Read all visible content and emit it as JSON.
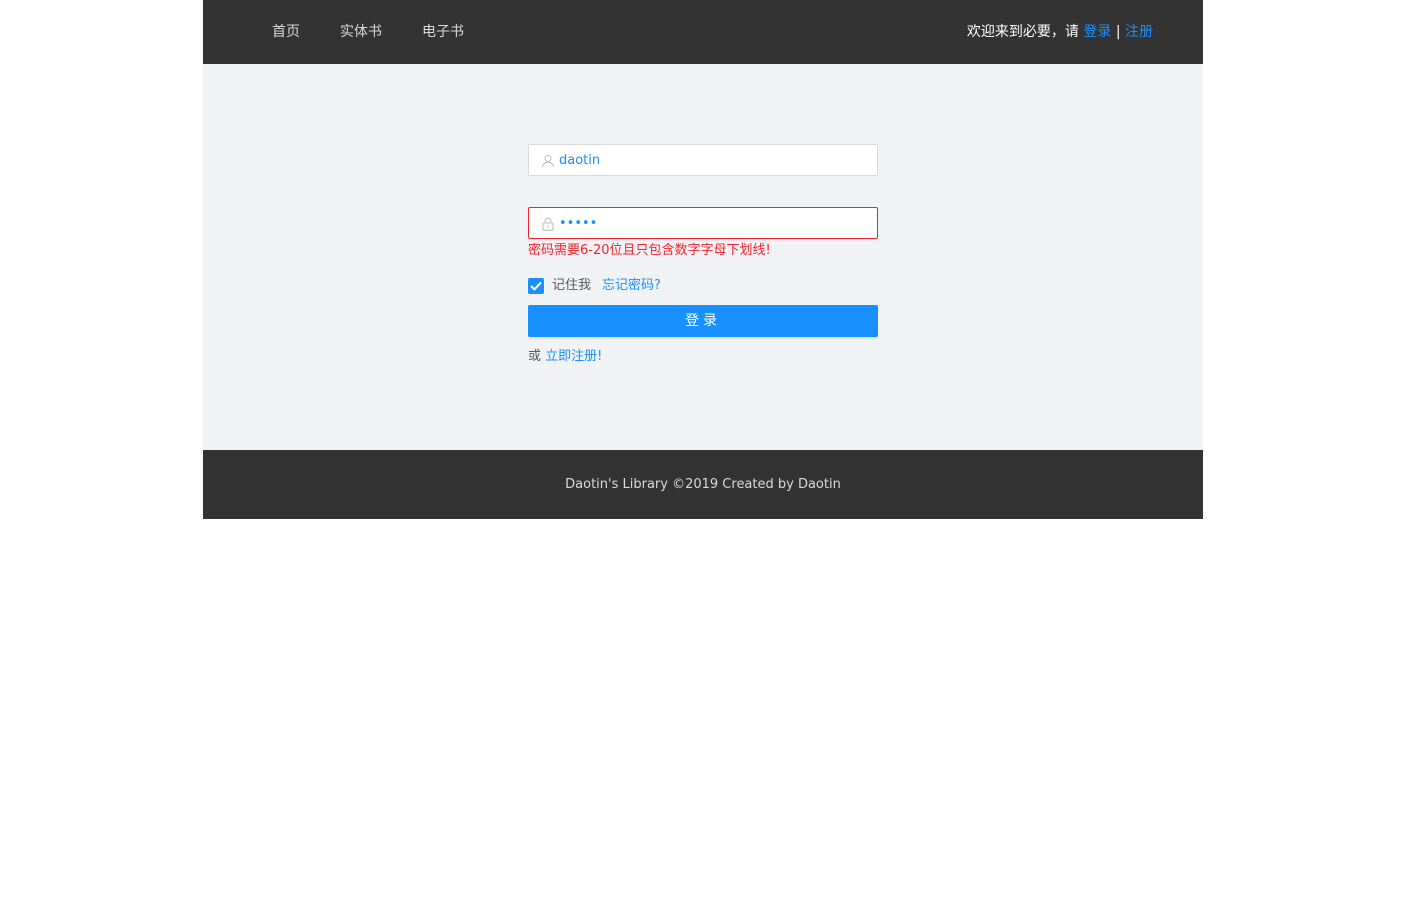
{
  "header": {
    "nav": [
      {
        "label": "首页"
      },
      {
        "label": "实体书"
      },
      {
        "label": "电子书"
      }
    ],
    "welcome_text": "欢迎来到必要，请 ",
    "login_link": "登录",
    "separator": " | ",
    "register_link": "注册"
  },
  "form": {
    "username_value": "daotin",
    "username_icon": "user-icon",
    "password_value": "•••••",
    "password_icon": "lock-icon",
    "password_error": "密码需要6-20位且只包含数字字母下划线!",
    "remember_label": "记住我",
    "remember_checked": true,
    "forgot_link": "忘记密码?",
    "login_button": "登录",
    "register_prefix": "或 ",
    "register_link": "立即注册!"
  },
  "footer": {
    "text": "Daotin's Library ©2019 Created by Daotin"
  },
  "colors": {
    "header_bg": "#333333",
    "page_bg": "#f0f2f5",
    "primary": "#1890ff",
    "error": "#f5222d"
  }
}
